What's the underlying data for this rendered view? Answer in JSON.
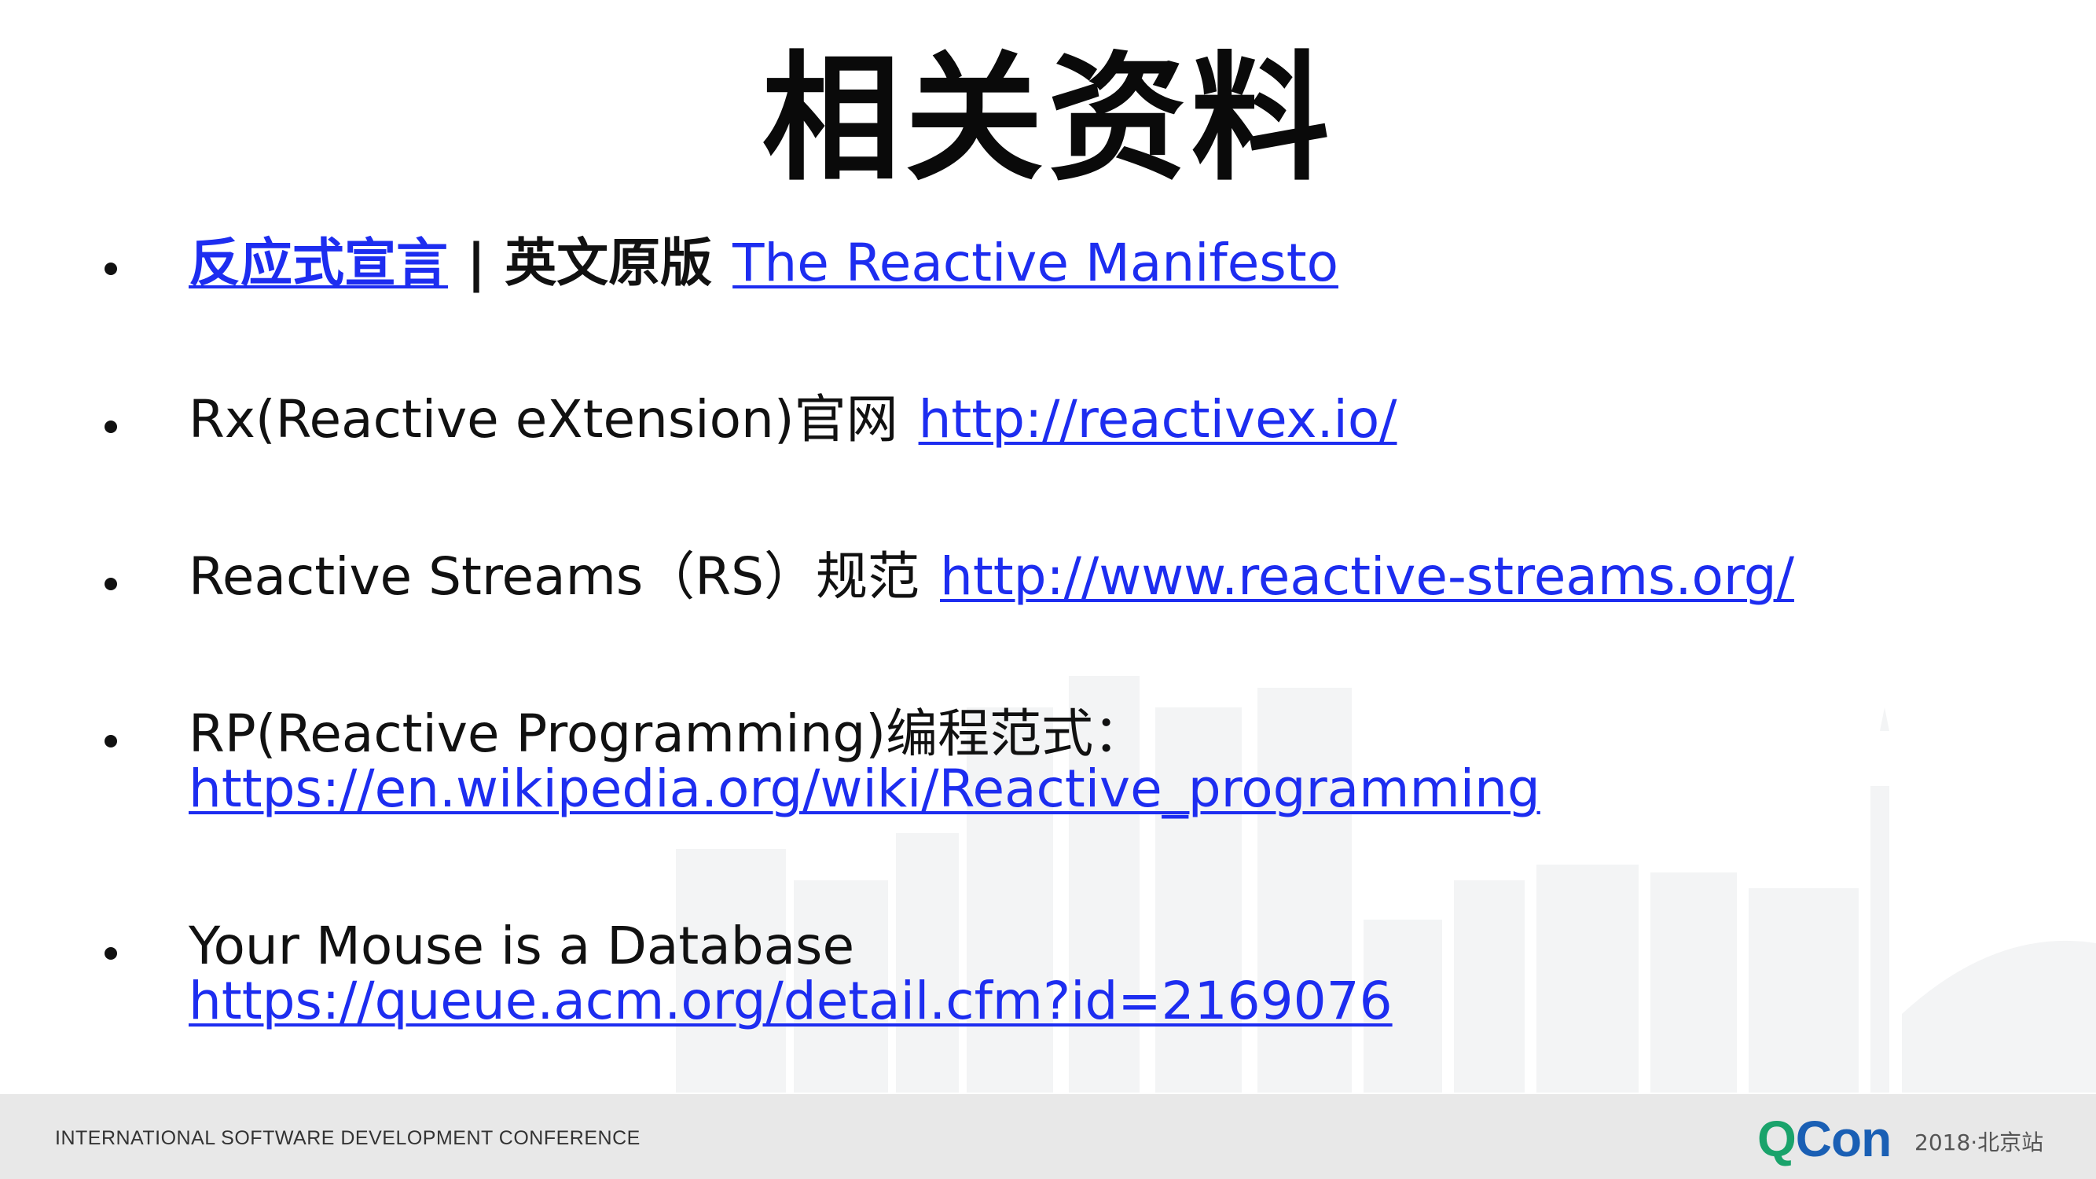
{
  "slide": {
    "title": "相关资料",
    "items": [
      {
        "link1": "反应式宣言",
        "separator": "|",
        "label": "英文原版",
        "link2": "The Reactive Manifesto"
      },
      {
        "label": "Rx(Reactive eXtension)官网",
        "link": "http://reactivex.io/"
      },
      {
        "label": "Reactive Streams（RS）规范",
        "link": "http://www.reactive-streams.org/"
      },
      {
        "label": "RP(Reactive Programming)编程范式：",
        "link": "https://en.wikipedia.org/wiki/Reactive_programming"
      },
      {
        "label": "Your Mouse is a Database",
        "link": "https://queue.acm.org/detail.cfm?id=2169076"
      }
    ]
  },
  "footer": {
    "conference": "INTERNATIONAL SOFTWARE DEVELOPMENT CONFERENCE",
    "logo_q": "Q",
    "logo_con": "Con",
    "edition": "2018·北京站"
  },
  "colors": {
    "link": "#1d2df0",
    "text": "#111111",
    "footer_bg": "#e8e8e8",
    "logo_green": "#1aa36b",
    "logo_blue": "#1a5fb4"
  }
}
